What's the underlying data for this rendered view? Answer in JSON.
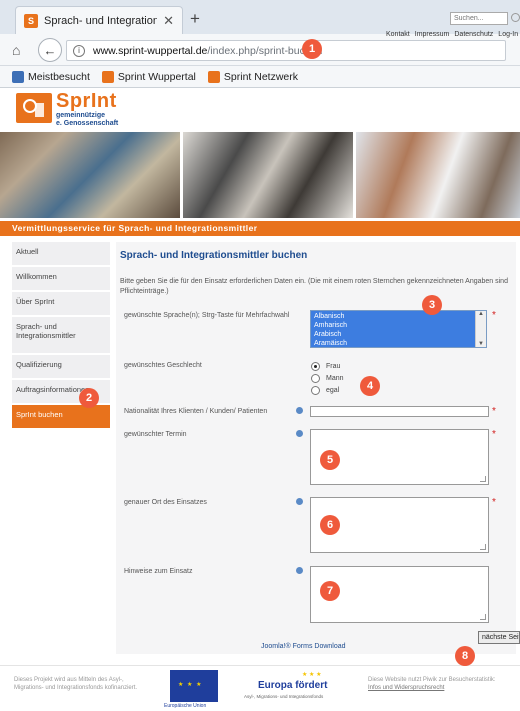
{
  "browser": {
    "tab_title": "Sprach- und Integrationsmi",
    "tab_favicon": "S",
    "url_host": "www.sprint-wuppertal.de",
    "url_path": "/index.php/sprint-buchen",
    "bookmarks": [
      "Meistbesucht",
      "Sprint Wuppertal",
      "Sprint Netzwerk"
    ]
  },
  "site": {
    "logo_name": "SprInt",
    "logo_sub_1": "gemeinnützige",
    "logo_sub_2": "e. Genossenschaft",
    "search_placeholder": "Suchen...",
    "top_links": [
      "Kontakt",
      "Impressum",
      "Datenschutz",
      "Log-In"
    ],
    "banner": "Vermittlungsservice für Sprach- und Integrationsmittler"
  },
  "sidebar": {
    "items": [
      "Aktuell",
      "Willkommen",
      "Über SprInt",
      "Sprach- und Integrationsmittler",
      "Qualifizierung",
      "Auftragsinformationen",
      "SprInt buchen"
    ]
  },
  "form": {
    "title": "Sprach- und Integrationsmittler buchen",
    "intro": "Bitte geben Sie die für den Einsatz erforderlichen Daten ein. (Die mit einem roten Sternchen gekennzeichneten Angaben sind Pflichteinträge.)",
    "languages_label": "gewünschte Sprache(n); Strg-Taste für Mehrfachwahl",
    "languages": [
      "Albanisch",
      "Amharisch",
      "Arabisch",
      "Aramäisch"
    ],
    "gender_label": "gewünschtes Geschlecht",
    "gender_options": [
      "Frau",
      "Mann",
      "egal"
    ],
    "gender_selected": "Frau",
    "nationality_label": "Nationalität Ihres Klienten / Kunden/ Patienten",
    "date_label": "gewünschter Termin",
    "location_label": "genauer Ort des Einsatzes",
    "notes_label": "Hinweise zum Einsatz",
    "credit": "Joomla!® Forms Download",
    "next_button": "nächste Seite"
  },
  "footer": {
    "project_text": "Dieses Projekt wird aus Mitteln des Asyl-, Migrations- und Integrationsfonds kofinanziert.",
    "eu_caption": "Europäische Union",
    "europa_title": "Europa fördert",
    "europa_sub": "Asyl-, Migrations- und Integrationsfonds",
    "cookie_text": "Diese Website nutzt Piwik zur Besucherstatistik:",
    "cookie_link": "Infos und Widerspruchsrecht"
  },
  "annotations": [
    "1",
    "2",
    "3",
    "4",
    "5",
    "6",
    "7",
    "8"
  ],
  "colors": {
    "accent": "#e8721c",
    "badge": "#ef5a3c",
    "link": "#1e4c8f",
    "selection": "#3d7de0"
  }
}
